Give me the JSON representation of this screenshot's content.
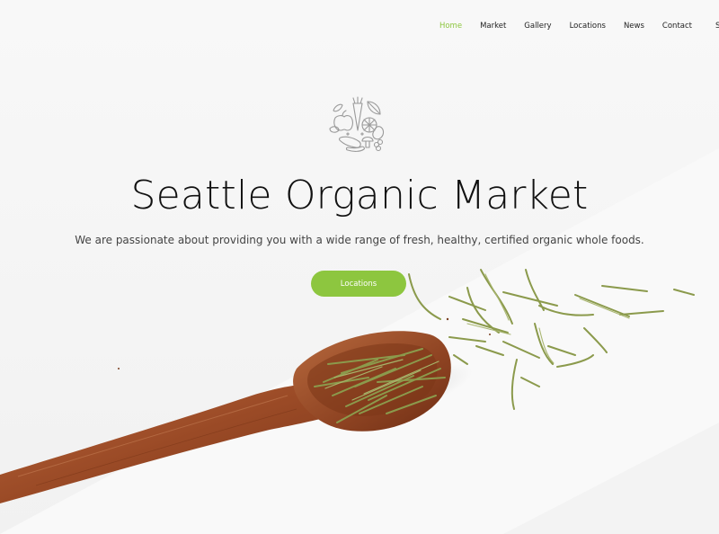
{
  "nav": {
    "items": [
      {
        "label": "Home",
        "active": true
      },
      {
        "label": "Market",
        "active": false
      },
      {
        "label": "Gallery",
        "active": false
      },
      {
        "label": "Locations",
        "active": false
      },
      {
        "label": "News",
        "active": false
      },
      {
        "label": "Contact",
        "active": false
      }
    ],
    "overflow_glyph": "S"
  },
  "hero": {
    "title": "Seattle Organic Market",
    "subtitle": "We are passionate about providing you with a wide range of fresh, healthy, certified organic whole foods.",
    "cta_label": "Locations"
  },
  "colors": {
    "accent": "#8dc63f",
    "spoon": "#a2502a",
    "herb": "#8b9a4c"
  },
  "icons": {
    "logo": "produce-circle-logo-icon"
  }
}
